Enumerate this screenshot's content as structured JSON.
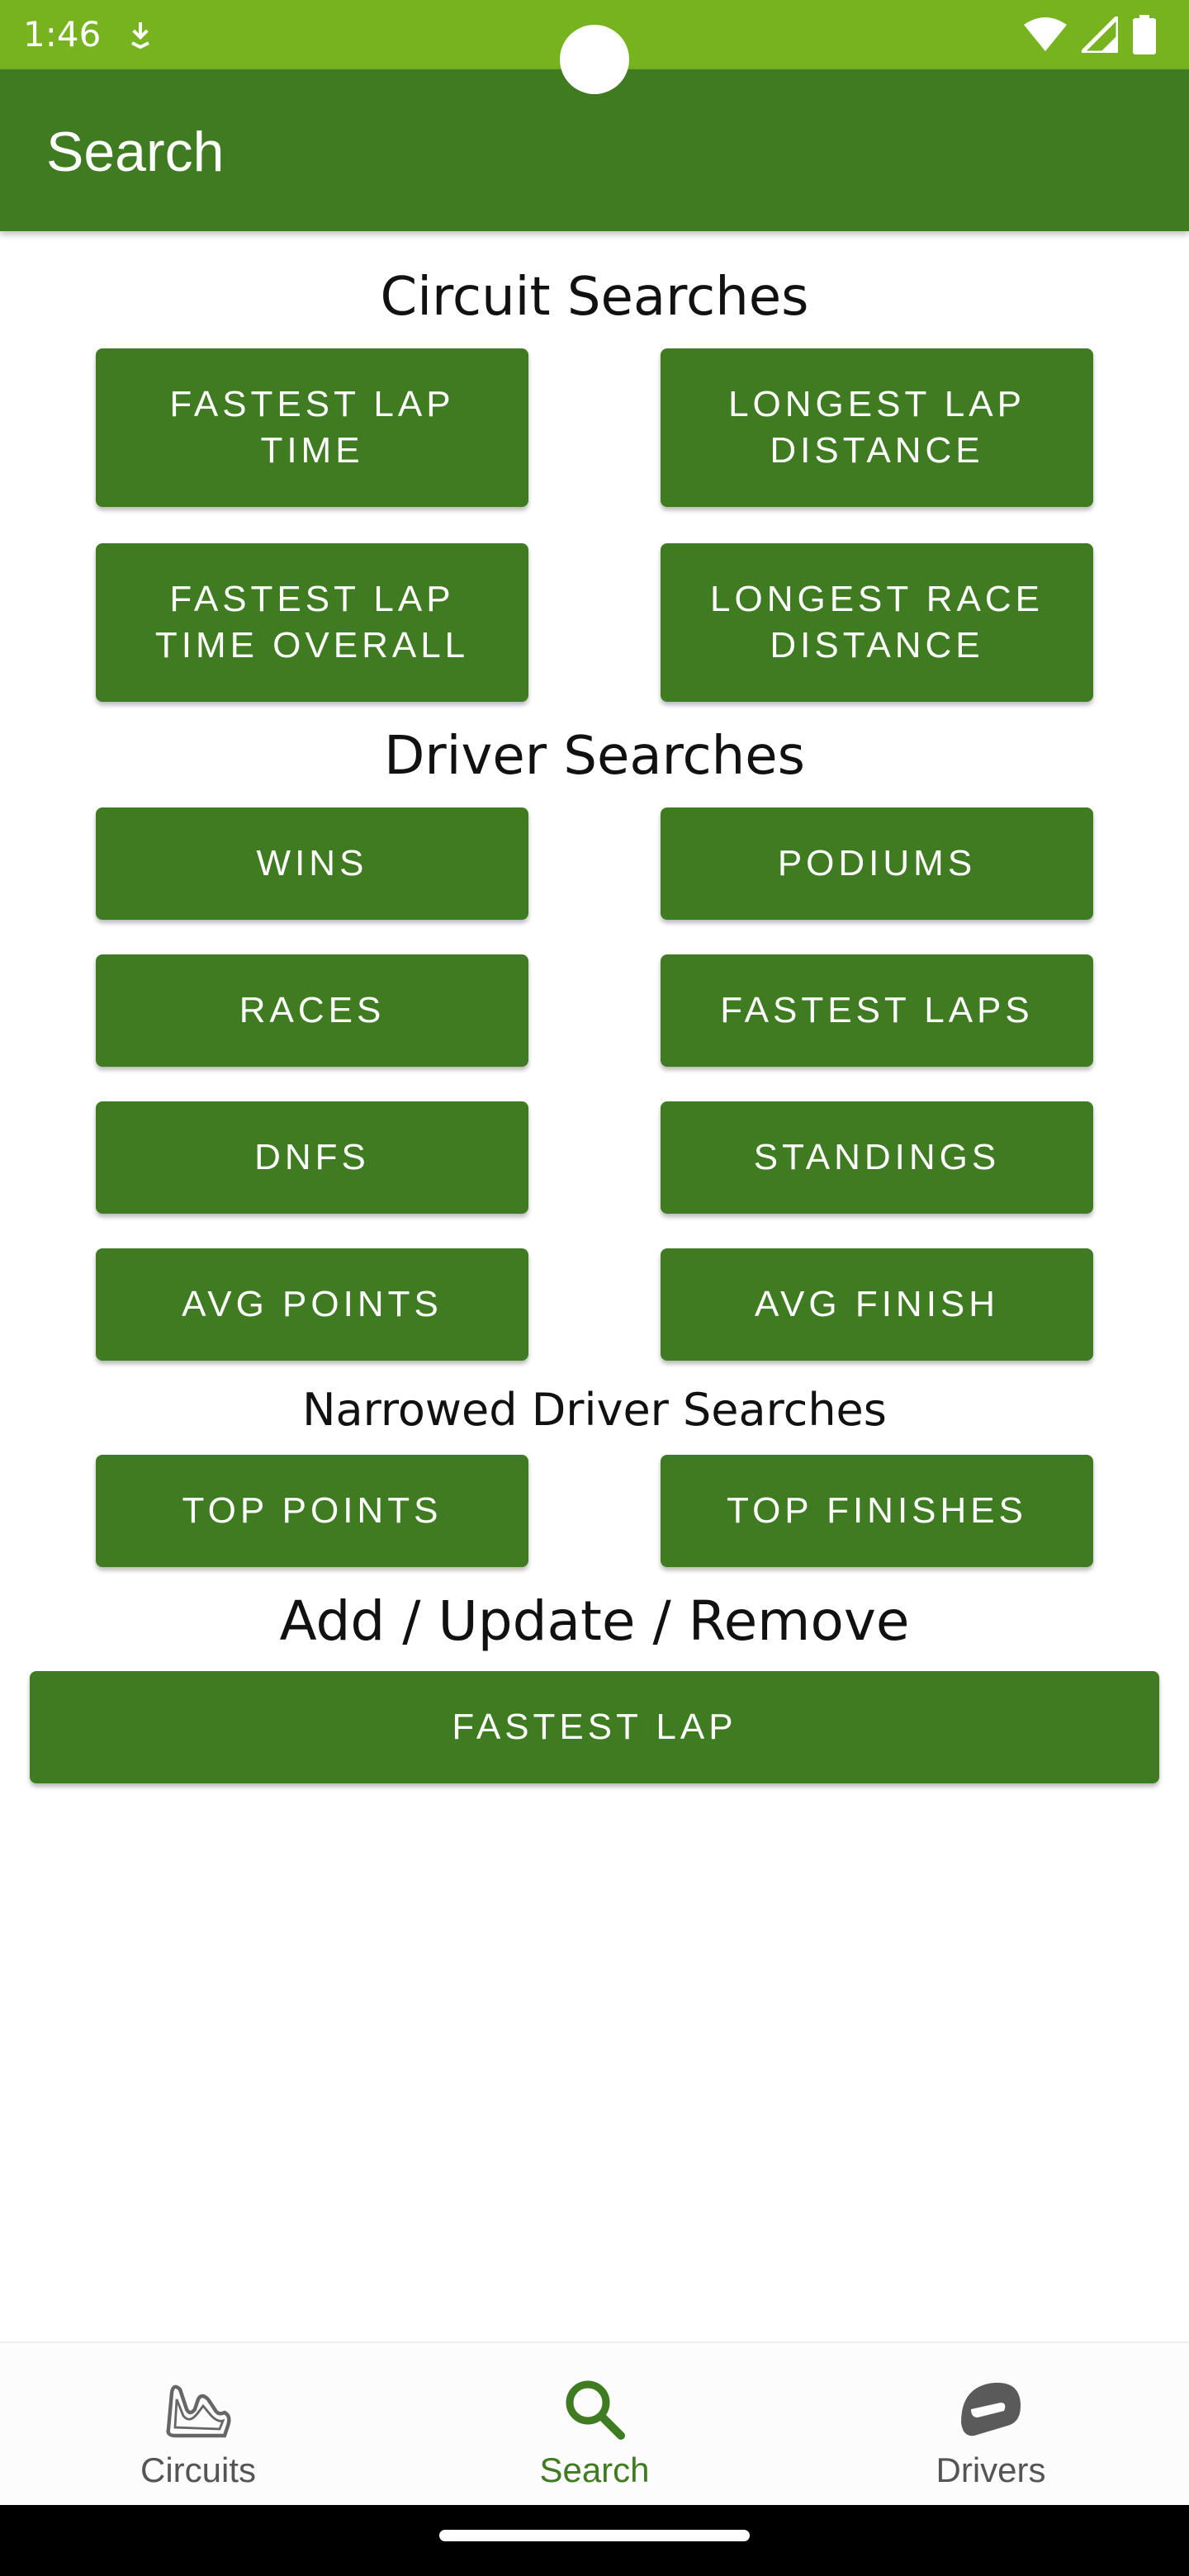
{
  "status_bar": {
    "time": "1:46",
    "icons": [
      "download-icon",
      "wifi-icon",
      "cell-signal-icon",
      "battery-icon"
    ]
  },
  "app_bar": {
    "title": "Search"
  },
  "sections": {
    "circuit": {
      "title": "Circuit Searches",
      "buttons": [
        "FASTEST LAP TIME",
        "LONGEST LAP DISTANCE",
        "FASTEST LAP TIME OVERALL",
        "LONGEST RACE DISTANCE"
      ]
    },
    "driver": {
      "title": "Driver Searches",
      "buttons": [
        "WINS",
        "PODIUMS",
        "RACES",
        "FASTEST LAPS",
        "DNFS",
        "STANDINGS",
        "AVG POINTS",
        "AVG FINISH"
      ]
    },
    "narrowed": {
      "title": "Narrowed Driver Searches",
      "buttons": [
        "TOP POINTS",
        "TOP FINISHES"
      ]
    },
    "manage": {
      "title": "Add / Update / Remove",
      "buttons": [
        "FASTEST LAP"
      ]
    }
  },
  "bottom_nav": {
    "items": [
      {
        "label": "Circuits",
        "icon": "circuit-track-icon",
        "active": false
      },
      {
        "label": "Search",
        "icon": "search-icon",
        "active": true
      },
      {
        "label": "Drivers",
        "icon": "helmet-icon",
        "active": false
      }
    ]
  },
  "colors": {
    "status_bar": "#76b31f",
    "app_bar": "#3f7b20",
    "button": "#3f7b20",
    "active_nav": "#3f7b20",
    "inactive_nav": "#555555"
  }
}
